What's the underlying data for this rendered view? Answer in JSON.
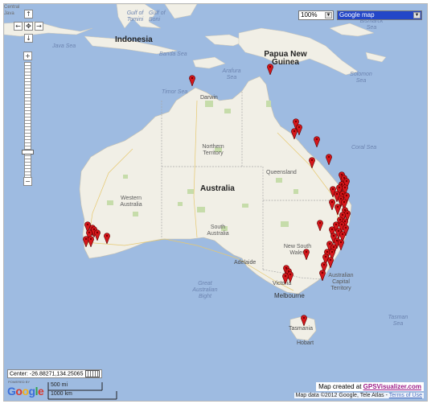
{
  "zoom": {
    "select_value": "100%"
  },
  "map_type": {
    "select_value": "Google map"
  },
  "labels": {
    "indonesia": "Indonesia",
    "png": "Papua New Guinea",
    "australia": "Australia",
    "java_sea": "Java Sea",
    "banda_sea": "Banda Sea",
    "timor_sea": "Timor Sea",
    "arafura_sea": "Arafura Sea",
    "gulf_tomini": "Gulf of Tomini",
    "gulf_boni": "Gulf of Boni",
    "bismarck_sea": "Bismarck Sea",
    "solomon_sea": "Solomon Sea",
    "coral_sea": "Coral Sea",
    "tasman_sea": "Tasman Sea",
    "great_bight": "Great Australian Bight",
    "darwin": "Darwin",
    "nt": "Northern Territory",
    "qld": "Queensland",
    "wa": "Western Australia",
    "sa": "South Australia",
    "nsw": "New South Wales",
    "act": "Australian Capital Territory",
    "adelaide": "Adelaide",
    "victoria": "Victoria",
    "melbourne": "Melbourne",
    "tasmania": "Tasmania",
    "hobart": "Hobart",
    "top_left_frag": "Central Java"
  },
  "center": {
    "text": "Center: -26.88271,134.25065"
  },
  "logo": {
    "powered": "POWERED BY",
    "word": "Google"
  },
  "scale": {
    "mi": "500 mi",
    "km": "1000 km"
  },
  "credit": {
    "prefix": "Map created at ",
    "link": "GPSVisualizer.com"
  },
  "map_data": {
    "text": "Map data ©2012 Google, Tele Atlas - ",
    "terms": "Terms of Use"
  },
  "colors": {
    "water": "#9ebbe1",
    "land": "#f1efe6",
    "park": "#c6dcaa",
    "marker": "#d6161b"
  }
}
